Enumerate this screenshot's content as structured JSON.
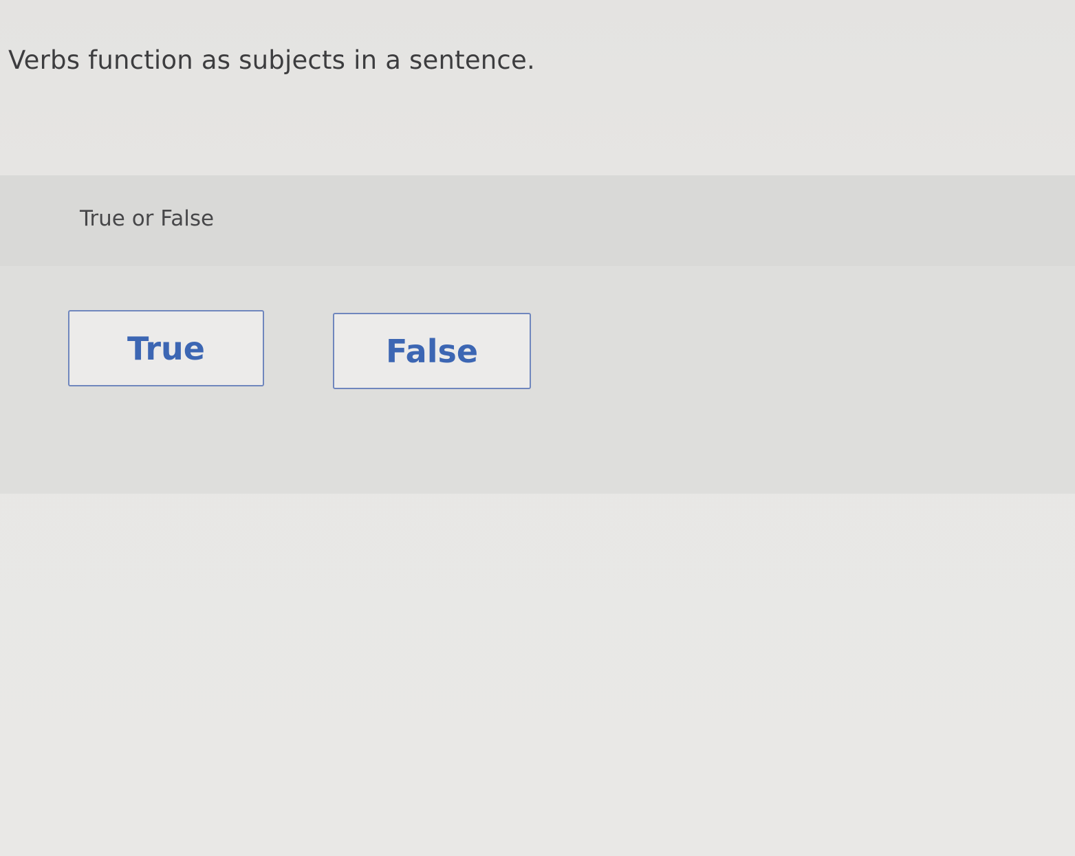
{
  "question": {
    "text": "Verbs function as subjects in a sentence."
  },
  "answer_panel": {
    "prompt": "True or False",
    "choices": [
      {
        "label": "True"
      },
      {
        "label": "False"
      }
    ]
  },
  "colors": {
    "button_text": "#3c66b3",
    "button_border": "#6f86bd",
    "question_text": "#3d3d3f"
  }
}
